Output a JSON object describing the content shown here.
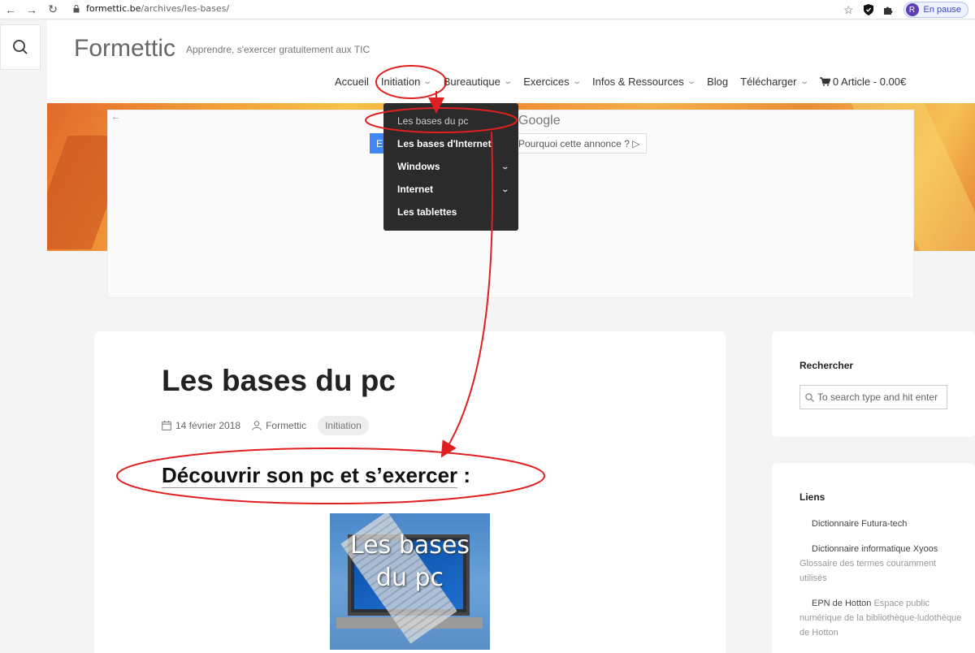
{
  "browser": {
    "url_host": "formettic.be",
    "url_path": "/archives/les-bases/",
    "profile_initial": "R",
    "profile_status": "En pause"
  },
  "site": {
    "brand": "Formettic",
    "tagline": "Apprendre, s'exercer gratuitement aux TIC"
  },
  "menu": {
    "items": [
      {
        "label": "Accueil",
        "has_children": false
      },
      {
        "label": "Initiation",
        "has_children": true
      },
      {
        "label": "Bureautique",
        "has_children": true
      },
      {
        "label": "Exercices",
        "has_children": true
      },
      {
        "label": "Infos & Ressources",
        "has_children": true
      },
      {
        "label": "Blog",
        "has_children": false
      },
      {
        "label": "Télécharger",
        "has_children": true
      }
    ],
    "cart": "0 Article - 0.00€"
  },
  "dropdown": {
    "items": [
      {
        "label": "Les bases du pc"
      },
      {
        "label": "Les bases d'Internet"
      },
      {
        "label": "Windows"
      },
      {
        "label": "Internet"
      },
      {
        "label": "Les tablettes"
      }
    ]
  },
  "ad": {
    "provider": "Google",
    "why_label": "Pourquoi cette annonce ? ▷",
    "partial_button": "E"
  },
  "post": {
    "title": "Les bases du pc",
    "date": "14 février 2018",
    "author": "Formettic",
    "category": "Initiation",
    "subheading": "Découvrir son pc et s’exercer",
    "subheading_suffix": " :",
    "thumb_line1": "Les bases",
    "thumb_line2": "du pc"
  },
  "sidebar": {
    "search_title": "Rechercher",
    "search_placeholder": "To search type and hit enter",
    "links_title": "Liens",
    "links": [
      {
        "name": "Dictionnaire Futura-tech",
        "desc": ""
      },
      {
        "name": "Dictionnaire informatique Xyoos",
        "desc": "Glossaire des termes couramment utilisés"
      },
      {
        "name": "EPN de Hotton",
        "desc": "Espace public numérique de la bibliothèque-ludothèque de Hotton"
      }
    ]
  },
  "colors": {
    "annotation": "#e02020",
    "dropdown_bg": "#2b2b2b"
  }
}
